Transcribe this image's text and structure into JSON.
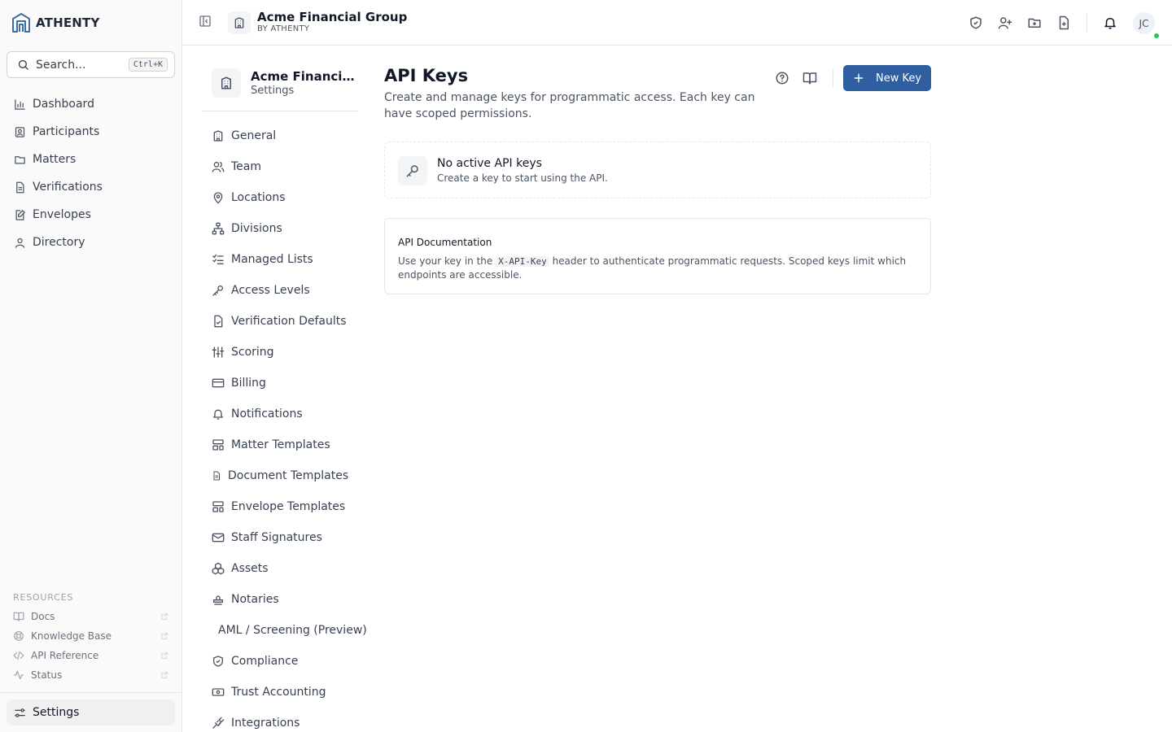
{
  "brand": {
    "name": "ATHENTY"
  },
  "search": {
    "placeholder": "Search...",
    "shortcut": "Ctrl+K"
  },
  "nav": {
    "items": [
      {
        "label": "Dashboard",
        "icon": "bar-chart-icon"
      },
      {
        "label": "Participants",
        "icon": "id-card-icon"
      },
      {
        "label": "Matters",
        "icon": "folder-icon"
      },
      {
        "label": "Verifications",
        "icon": "document-icon"
      },
      {
        "label": "Envelopes",
        "icon": "envelope-edit-icon"
      },
      {
        "label": "Directory",
        "icon": "users-icon"
      }
    ]
  },
  "resources": {
    "title": "RESOURCES",
    "items": [
      {
        "label": "Docs",
        "icon": "book-icon"
      },
      {
        "label": "Knowledge Base",
        "icon": "lifebuoy-icon"
      },
      {
        "label": "API Reference",
        "icon": "code-icon"
      },
      {
        "label": "Status",
        "icon": "activity-icon"
      }
    ]
  },
  "settings_nav": {
    "label": "Settings"
  },
  "topbar": {
    "org_name": "Acme Financial Group",
    "org_sub": "BY ATHENTY",
    "avatar_initials": "JC"
  },
  "settings_panel": {
    "title": "Acme Financial Group",
    "subtitle": "Settings",
    "items": [
      "General",
      "Team",
      "Locations",
      "Divisions",
      "Managed Lists",
      "Access Levels",
      "Verification Defaults",
      "Scoring",
      "Billing",
      "Notifications",
      "Matter Templates",
      "Document Templates",
      "Envelope Templates",
      "Staff Signatures",
      "Assets",
      "Notaries",
      "AML / Screening (Preview)",
      "Compliance",
      "Trust Accounting",
      "Integrations"
    ]
  },
  "main": {
    "title": "API Keys",
    "description": "Create and manage keys for programmatic access. Each key can have scoped permissions.",
    "new_key_label": "New Key",
    "empty": {
      "title": "No active API keys",
      "subtitle": "Create a key to start using the API."
    },
    "doc": {
      "title": "API Documentation",
      "text_before": "Use your key in the",
      "code": "X-API-Key",
      "text_after": "header to authenticate programmatic requests. Scoped keys limit which endpoints are accessible."
    }
  },
  "colors": {
    "primary": "#2f5fa0",
    "brand": "#3a6ea5",
    "presence": "#22c55e"
  }
}
